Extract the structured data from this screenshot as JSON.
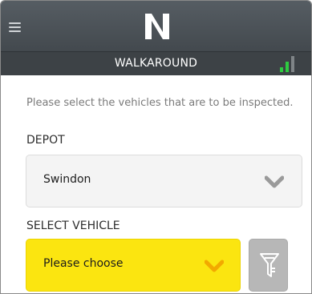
{
  "header": {
    "logo_text": "N",
    "menu_icon": "hamburger-menu-icon",
    "title": "WALKAROUND",
    "signal_icon": "signal-strength-icon",
    "signal": {
      "bars_total": 3,
      "bars_active": 2,
      "active_color": "#2ecc40",
      "inactive_color": "#7f8487"
    }
  },
  "form": {
    "intro_text": "Please select the vehicles that are to be inspected.",
    "depot_label": "DEPOT",
    "depot_value": "Swindon",
    "vehicle_label": "SELECT VEHICLE",
    "vehicle_value": "Please choose",
    "filter_icon": "funnel-filter-icon"
  },
  "colors": {
    "header_bg": "#4b5156",
    "subbar_bg": "#3d4246",
    "vehicle_select_bg": "#fbe510",
    "vehicle_chevron": "#f2a900",
    "depot_chevron": "#9a9a9a",
    "filter_button_bg": "#b7b7b7"
  }
}
